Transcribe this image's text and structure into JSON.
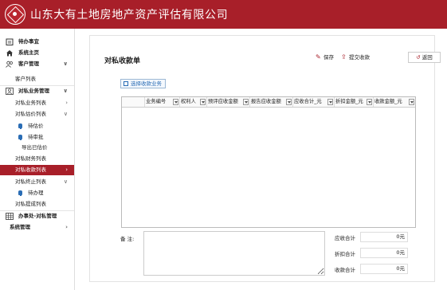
{
  "header": {
    "company": "山东大有土地房地产资产评估有限公司"
  },
  "sidebar": {
    "items": [
      {
        "label": "待办事宜",
        "icon": "clipboard-icon"
      },
      {
        "label": "系统主页",
        "icon": "home-icon"
      },
      {
        "label": "客户管理",
        "icon": "users-icon"
      },
      {
        "label": "客户列表"
      },
      {
        "label": "对私业务管理",
        "icon": "person-icon"
      },
      {
        "label": "对私业务列表"
      },
      {
        "label": "对私估价列表"
      },
      {
        "label": "待估价"
      },
      {
        "label": "待审批"
      },
      {
        "label": "导出已估价"
      },
      {
        "label": "对私财务列表"
      },
      {
        "label": "对私收款列表"
      },
      {
        "label": "对私终止列表"
      },
      {
        "label": "待办理"
      },
      {
        "label": "对私提成列表"
      },
      {
        "label": "办事处-对私管理",
        "icon": "grid-icon"
      },
      {
        "label": "系统管理"
      }
    ]
  },
  "main": {
    "title": "对私收款单",
    "toolbar": {
      "save": "保存",
      "submit": "提交收款",
      "back": "返回"
    },
    "select_business": "选择收款业务",
    "grid": {
      "columns": [
        "业务编号",
        "权利人",
        "预评应收金额",
        "报告应收金额",
        "应收合计_元",
        "折扣金额_元",
        "收款金额_元"
      ]
    },
    "remark_label": "备  注:",
    "summary": [
      {
        "label": "应收合计",
        "value": "0元"
      },
      {
        "label": "折扣合计",
        "value": "0元"
      },
      {
        "label": "收款合计",
        "value": "0元"
      }
    ]
  },
  "colors": {
    "brand": "#a81f29",
    "link": "#2a6db5"
  }
}
